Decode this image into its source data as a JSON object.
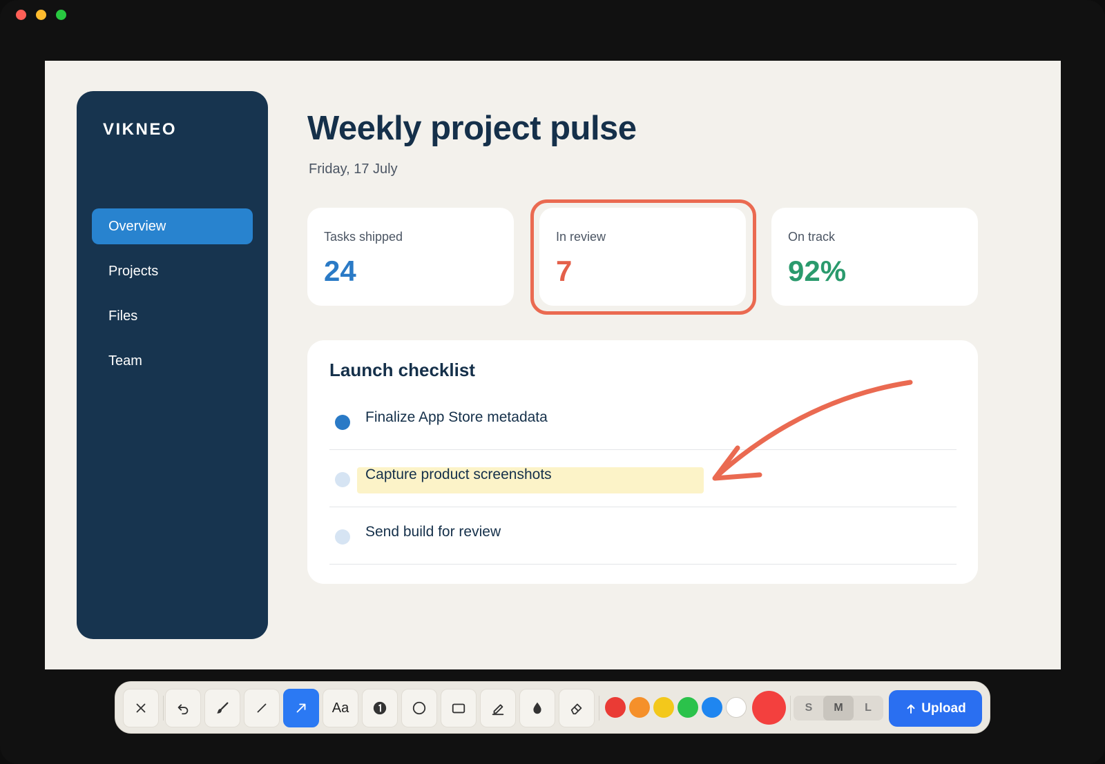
{
  "app": {
    "brand": "VIKNEO"
  },
  "sidebar": {
    "items": [
      {
        "label": "Overview",
        "active": true
      },
      {
        "label": "Projects"
      },
      {
        "label": "Files"
      },
      {
        "label": "Team"
      }
    ]
  },
  "page": {
    "title": "Weekly project pulse",
    "date": "Friday, 17 July"
  },
  "stats": [
    {
      "label": "Tasks shipped",
      "value": "24",
      "color": "#2a7ac6"
    },
    {
      "label": "In review",
      "value": "7",
      "color": "#e4604a"
    },
    {
      "label": "On track",
      "value": "92%",
      "color": "#2a9a6d"
    }
  ],
  "checklist": {
    "title": "Launch checklist",
    "items": [
      {
        "text": "Finalize App Store metadata",
        "done": true
      },
      {
        "text": "Capture product screenshots",
        "done": false,
        "highlighted": true
      },
      {
        "text": "Send build for review",
        "done": false
      }
    ]
  },
  "annotation": {
    "color": "#ea6a51"
  },
  "toolbar": {
    "tools": [
      "close-icon",
      "undo-icon",
      "brush-icon",
      "line-icon",
      "arrow-icon",
      "text-tool",
      "numbered-marker-icon",
      "circle-icon",
      "rectangle-icon",
      "highlighter-icon",
      "blur-drop-icon",
      "eraser-icon"
    ],
    "text_tool_label": "Aa",
    "colors": [
      "#ea3b35",
      "#f5902a",
      "#f3c81b",
      "#2bc24b",
      "#1f86f0",
      "#ffffff"
    ],
    "selected_color": "#f3403e",
    "sizes": [
      "S",
      "M",
      "L"
    ],
    "selected_size": "M",
    "upload_label": "Upload"
  }
}
